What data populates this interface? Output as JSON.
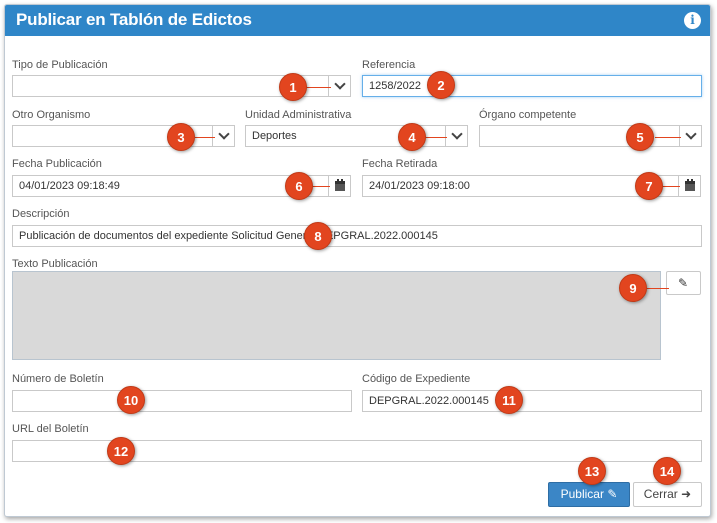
{
  "dialog": {
    "title": "Publicar en Tablón de Edictos",
    "info_icon_glyph": "i"
  },
  "fields": {
    "tipo_publicacion": {
      "label": "Tipo de Publicación",
      "value": ""
    },
    "referencia": {
      "label": "Referencia",
      "value": "1258/2022"
    },
    "otro_organismo": {
      "label": "Otro Organismo",
      "value": ""
    },
    "unidad_administrativa": {
      "label": "Unidad Administrativa",
      "value": "Deportes"
    },
    "organo_competente": {
      "label": "Órgano competente",
      "value": ""
    },
    "fecha_publicacion": {
      "label": "Fecha Publicación",
      "value": "04/01/2023 09:18:49"
    },
    "fecha_retirada": {
      "label": "Fecha Retirada",
      "value": "24/01/2023 09:18:00"
    },
    "descripcion": {
      "label": "Descripción",
      "value": "Publicación de documentos del expediente Solicitud General DEPGRAL.2022.000145"
    },
    "texto_publicacion": {
      "label": "Texto Publicación",
      "value": ""
    },
    "numero_boletin": {
      "label": "Número de Boletín",
      "value": ""
    },
    "codigo_expediente": {
      "label": "Código de Expediente",
      "value": "DEPGRAL.2022.000145"
    },
    "url_boletin": {
      "label": "URL del Boletín",
      "value": ""
    }
  },
  "buttons": {
    "publicar": {
      "label": "Publicar",
      "icon": "edit-icon"
    },
    "cerrar": {
      "label": "Cerrar",
      "icon": "sign-out-icon"
    }
  },
  "callouts": [
    "1",
    "2",
    "3",
    "4",
    "5",
    "6",
    "7",
    "8",
    "9",
    "10",
    "11",
    "12",
    "13",
    "14"
  ],
  "colors": {
    "header": "#2f86c8",
    "primary_button": "#3b86c6",
    "callout": "#e2451f",
    "textarea_bg": "#d9d9d9"
  }
}
